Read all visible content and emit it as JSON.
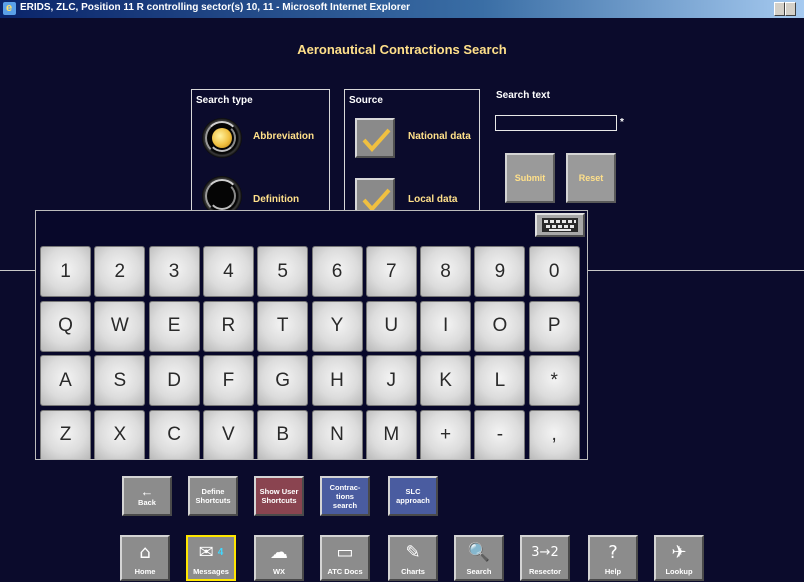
{
  "window": {
    "title": "ERIDS, ZLC, Position 11 R controlling sector(s) 10, 11 - Microsoft Internet Explorer"
  },
  "page": {
    "title": "Aeronautical Contractions Search"
  },
  "search_type": {
    "label": "Search type",
    "options": [
      {
        "label": "Abbreviation",
        "selected": true
      },
      {
        "label": "Definition",
        "selected": false
      }
    ]
  },
  "source": {
    "label": "Source",
    "options": [
      {
        "label": "National data",
        "checked": true
      },
      {
        "label": "Local data",
        "checked": true
      }
    ]
  },
  "search_text": {
    "label": "Search text",
    "value": "",
    "required_mark": "*"
  },
  "actions": {
    "submit": "Submit",
    "reset": "Reset"
  },
  "keyboard": {
    "icon": "keyboard-icon",
    "rows": [
      [
        "1",
        "2",
        "3",
        "4",
        "5",
        "6",
        "7",
        "8",
        "9",
        "0"
      ],
      [
        "Q",
        "W",
        "E",
        "R",
        "T",
        "Y",
        "U",
        "I",
        "O",
        "P"
      ],
      [
        "A",
        "S",
        "D",
        "F",
        "G",
        "H",
        "J",
        "K",
        "L",
        "*"
      ],
      [
        "Z",
        "X",
        "C",
        "V",
        "B",
        "N",
        "M",
        "+",
        "-",
        ","
      ]
    ]
  },
  "toolbar_top": [
    {
      "label": "Back",
      "icon": "arrow-left-icon",
      "glyph": "←",
      "style": "gray"
    },
    {
      "label": "Define Shortcuts",
      "style": "gray"
    },
    {
      "label": "Show User Shortcuts",
      "style": "red"
    },
    {
      "label": "Contrac- tions search",
      "style": "blue"
    },
    {
      "label": "SLC approach",
      "style": "blue"
    }
  ],
  "toolbar_bottom": [
    {
      "label": "Home",
      "icon": "home-icon",
      "glyph": "⌂"
    },
    {
      "label": "Messages",
      "icon": "messages-icon",
      "glyph": "✉",
      "badge": "4",
      "active": true
    },
    {
      "label": "WX",
      "icon": "weather-icon",
      "glyph": "☁"
    },
    {
      "label": "ATC Docs",
      "icon": "folder-icon",
      "glyph": "▭"
    },
    {
      "label": "Charts",
      "icon": "pen-icon",
      "glyph": "✎"
    },
    {
      "label": "Search",
      "icon": "search-icon",
      "glyph": "🔍"
    },
    {
      "label": "Resector",
      "icon": "resector-icon",
      "glyph": "3→2"
    },
    {
      "label": "Help",
      "icon": "help-icon",
      "glyph": "?"
    },
    {
      "label": "Lookup",
      "icon": "plane-icon",
      "glyph": "✈"
    }
  ],
  "colors": {
    "background": "#0b0b2c",
    "title_text": "#ffe08a",
    "button_gray": "#8c8c8c",
    "button_red": "#8a4450",
    "button_blue": "#4a5ca0",
    "active_outline": "#ffe600",
    "badge": "#40d8ff"
  }
}
